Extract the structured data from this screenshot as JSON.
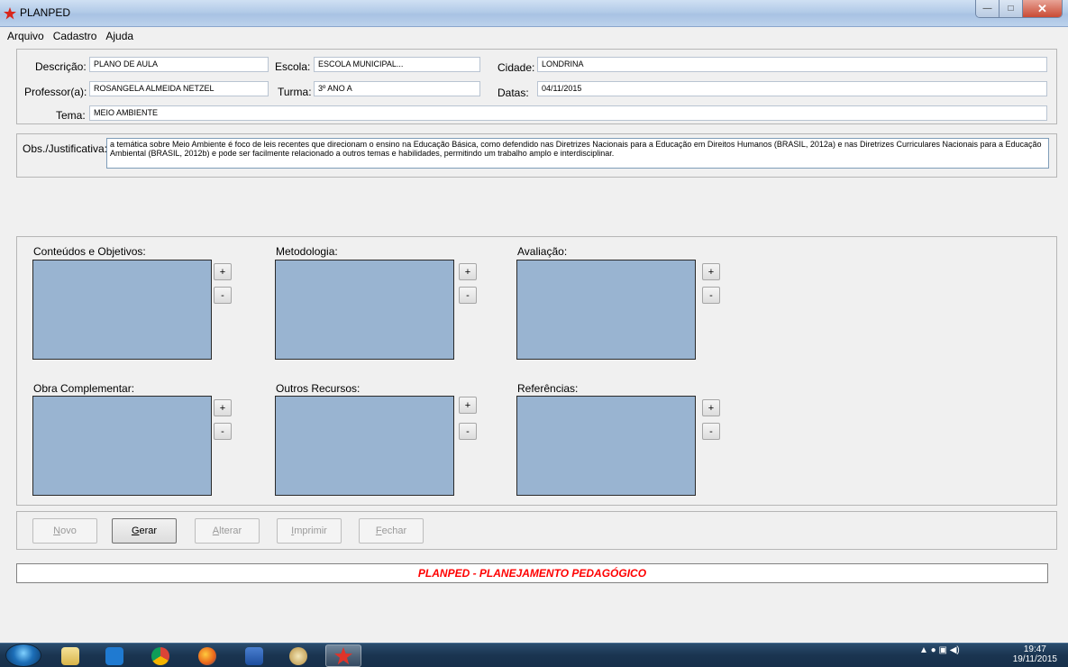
{
  "window": {
    "title": "PLANPED"
  },
  "menu": [
    "Arquivo",
    "Cadastro",
    "Ajuda"
  ],
  "header_fields": {
    "descricao": {
      "label": "Descrição:",
      "value": "PLANO DE AULA"
    },
    "escola": {
      "label": "Escola:",
      "value": "ESCOLA MUNICIPAL..."
    },
    "cidade": {
      "label": "Cidade:",
      "value": "LONDRINA"
    },
    "professor": {
      "label": "Professor(a):",
      "value": "ROSANGELA ALMEIDA NETZEL"
    },
    "turma": {
      "label": "Turma:",
      "value": "3º ANO A"
    },
    "datas": {
      "label": "Datas:",
      "value": "04/11/2015"
    },
    "tema": {
      "label": "Tema:",
      "value": "MEIO AMBIENTE"
    }
  },
  "obs": {
    "label": "Obs./Justificativa:",
    "value": "a temática sobre Meio Ambiente é foco de leis recentes que direcionam o ensino na Educação Básica, como defendido nas Diretrizes Nacionais para a Educação em Direitos Humanos (BRASIL, 2012a) e nas Diretrizes Curriculares Nacionais para a Educação Ambiental (BRASIL, 2012b) e pode ser facilmente relacionado a outros temas e habilidades, permitindo um trabalho amplo e interdisciplinar."
  },
  "lists": {
    "conteudos": "Conteúdos e Objetivos:",
    "metodologia": "Metodologia:",
    "avaliacao": "Avaliação:",
    "obra": "Obra Complementar:",
    "recursos": "Outros Recursos:",
    "referencias": "Referências:",
    "add_label": "+",
    "remove_label": "-"
  },
  "actions": {
    "novo": "Novo",
    "gerar": "Gerar",
    "alterar": "Alterar",
    "imprimir": "Imprimir",
    "fechar": "Fechar"
  },
  "banner": {
    "text": "PLANPED - PLANEJAMENTO PEDAGÓGICO",
    "color": "#ff0000"
  },
  "taskbar": {
    "time": "19:47",
    "date": "19/11/2015"
  },
  "colors": {
    "listbox": "#99b4d1",
    "titlebar": "#b3cbe8",
    "taskbar": "#1a3450"
  }
}
